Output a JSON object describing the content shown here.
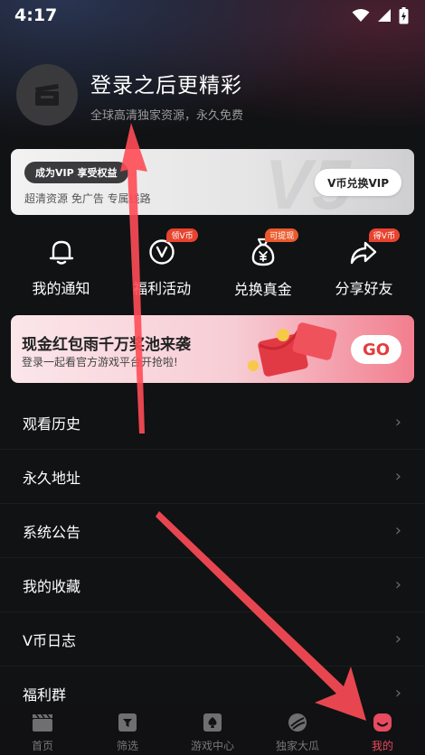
{
  "status_bar": {
    "time": "4:17"
  },
  "profile": {
    "title": "登录之后更精彩",
    "subtitle": "全球高清独家资源，永久免费"
  },
  "vip_card": {
    "badge": "成为VIP 享受权益",
    "features": "超清资源  免广告  专属线路",
    "button": "V币兑换VIP",
    "watermark": "V5"
  },
  "quick_actions": [
    {
      "label": "我的通知",
      "icon": "bell-icon",
      "badge": ""
    },
    {
      "label": "福利活动",
      "icon": "v-coin-icon",
      "badge": "领V币"
    },
    {
      "label": "兑换真金",
      "icon": "money-bag-icon",
      "badge": "可提现"
    },
    {
      "label": "分享好友",
      "icon": "share-icon",
      "badge": "得V币"
    }
  ],
  "promo": {
    "title": "现金红包雨千万奖池来袭",
    "subtitle": "登录一起看官方游戏平台开抢啦!",
    "button": "GO"
  },
  "menu": [
    {
      "label": "观看历史"
    },
    {
      "label": "永久地址"
    },
    {
      "label": "系统公告"
    },
    {
      "label": "我的收藏"
    },
    {
      "label": "V币日志"
    },
    {
      "label": "福利群"
    }
  ],
  "bottom_nav": [
    {
      "label": "首页",
      "icon": "clapperboard-icon"
    },
    {
      "label": "筛选",
      "icon": "filter-icon"
    },
    {
      "label": "游戏中心",
      "icon": "spade-card-icon"
    },
    {
      "label": "独家大瓜",
      "icon": "melon-icon"
    },
    {
      "label": "我的",
      "icon": "profile-icon",
      "active": true
    }
  ],
  "colors": {
    "accent": "#e84a5f",
    "arrow": "#ff4d57",
    "background": "#111214"
  }
}
